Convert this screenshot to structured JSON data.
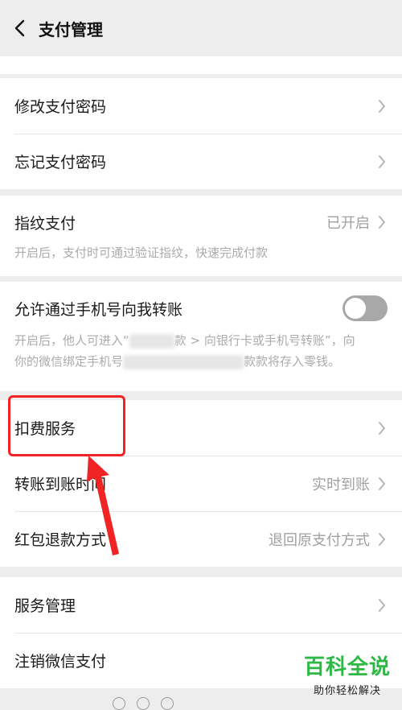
{
  "header": {
    "title": "支付管理"
  },
  "groups": {
    "password": {
      "change_label": "修改支付密码",
      "forgot_label": "忘记支付密码"
    },
    "fingerprint": {
      "label": "指纹支付",
      "value": "已开启",
      "desc": "开启后，支付时可通过验证指纹，快速完成付款"
    },
    "phone_transfer": {
      "label": "允许通过手机号向我转账",
      "toggle_on": false,
      "desc_line1_a": "开启后，他人可进入“",
      "desc_line1_b": "款 > 向银行卡或手机号转账”，向",
      "desc_line2_a": "你的微信绑定手机号",
      "desc_line2_b": "款款将存入零钱。"
    },
    "services": {
      "deduction_label": "扣费服务",
      "transfer_time_label": "转账到账时间",
      "transfer_time_value": "实时到账",
      "refund_label": "红包退款方式",
      "refund_value": "退回原支付方式"
    },
    "manage": {
      "service_manage_label": "服务管理",
      "cancel_wechat_pay_label": "注销微信支付"
    }
  },
  "watermark": {
    "main": "百科全说",
    "sub": "助你轻松解决"
  },
  "colors": {
    "accent_red": "#f02424",
    "watermark_green": "#2db844"
  }
}
